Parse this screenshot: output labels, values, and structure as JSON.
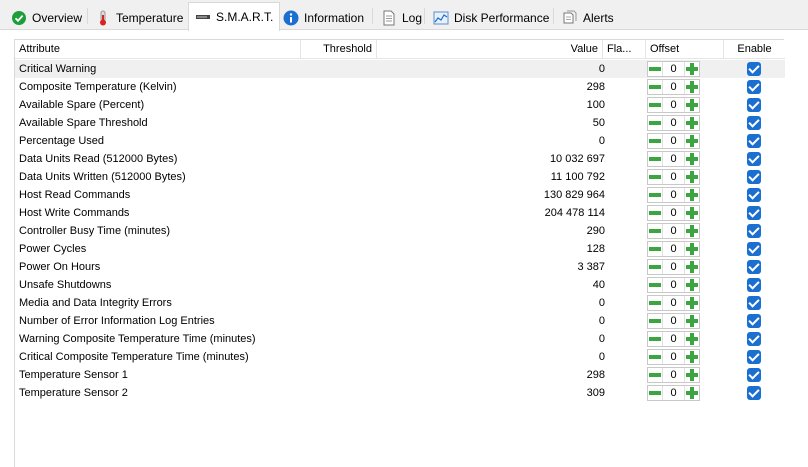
{
  "tabs": [
    {
      "label": "Overview",
      "icon": "check-circle-icon"
    },
    {
      "label": "Temperature",
      "icon": "thermometer-icon"
    },
    {
      "label": "S.M.A.R.T.",
      "icon": "drive-icon"
    },
    {
      "label": "Information",
      "icon": "info-icon"
    },
    {
      "label": "Log",
      "icon": "log-document-icon"
    },
    {
      "label": "Disk Performance",
      "icon": "performance-chart-icon"
    },
    {
      "label": "Alerts",
      "icon": "alerts-document-icon"
    }
  ],
  "active_tab": "S.M.A.R.T.",
  "columns": {
    "attribute": "Attribute",
    "threshold": "Threshold",
    "value": "Value",
    "flags": "Fla...",
    "offset": "Offset",
    "enable": "Enable"
  },
  "rows": [
    {
      "attribute": "Critical Warning",
      "threshold": "",
      "value": "0",
      "flags": "",
      "offset": "0",
      "enabled": true
    },
    {
      "attribute": "Composite Temperature (Kelvin)",
      "threshold": "",
      "value": "298",
      "flags": "",
      "offset": "0",
      "enabled": true
    },
    {
      "attribute": "Available Spare (Percent)",
      "threshold": "",
      "value": "100",
      "flags": "",
      "offset": "0",
      "enabled": true
    },
    {
      "attribute": "Available Spare Threshold",
      "threshold": "",
      "value": "50",
      "flags": "",
      "offset": "0",
      "enabled": true
    },
    {
      "attribute": "Percentage Used",
      "threshold": "",
      "value": "0",
      "flags": "",
      "offset": "0",
      "enabled": true
    },
    {
      "attribute": "Data Units Read (512000 Bytes)",
      "threshold": "",
      "value": "10 032 697",
      "flags": "",
      "offset": "0",
      "enabled": true
    },
    {
      "attribute": "Data Units Written (512000 Bytes)",
      "threshold": "",
      "value": "11 100 792",
      "flags": "",
      "offset": "0",
      "enabled": true
    },
    {
      "attribute": "Host Read Commands",
      "threshold": "",
      "value": "130 829 964",
      "flags": "",
      "offset": "0",
      "enabled": true
    },
    {
      "attribute": "Host Write Commands",
      "threshold": "",
      "value": "204 478 114",
      "flags": "",
      "offset": "0",
      "enabled": true
    },
    {
      "attribute": "Controller Busy Time (minutes)",
      "threshold": "",
      "value": "290",
      "flags": "",
      "offset": "0",
      "enabled": true
    },
    {
      "attribute": "Power Cycles",
      "threshold": "",
      "value": "128",
      "flags": "",
      "offset": "0",
      "enabled": true
    },
    {
      "attribute": "Power On Hours",
      "threshold": "",
      "value": "3 387",
      "flags": "",
      "offset": "0",
      "enabled": true
    },
    {
      "attribute": "Unsafe Shutdowns",
      "threshold": "",
      "value": "40",
      "flags": "",
      "offset": "0",
      "enabled": true
    },
    {
      "attribute": "Media and Data Integrity Errors",
      "threshold": "",
      "value": "0",
      "flags": "",
      "offset": "0",
      "enabled": true
    },
    {
      "attribute": "Number of Error Information Log Entries",
      "threshold": "",
      "value": "0",
      "flags": "",
      "offset": "0",
      "enabled": true
    },
    {
      "attribute": "Warning Composite Temperature Time (minutes)",
      "threshold": "",
      "value": "0",
      "flags": "",
      "offset": "0",
      "enabled": true
    },
    {
      "attribute": "Critical Composite Temperature Time (minutes)",
      "threshold": "",
      "value": "0",
      "flags": "",
      "offset": "0",
      "enabled": true
    },
    {
      "attribute": "Temperature Sensor 1",
      "threshold": "",
      "value": "298",
      "flags": "",
      "offset": "0",
      "enabled": true
    },
    {
      "attribute": "Temperature Sensor 2",
      "threshold": "",
      "value": "309",
      "flags": "",
      "offset": "0",
      "enabled": true
    }
  ],
  "colors": {
    "accent_green": "#3aa541",
    "checkbox_blue": "#1a6fd1",
    "selected_row": "#f0f0f0"
  }
}
